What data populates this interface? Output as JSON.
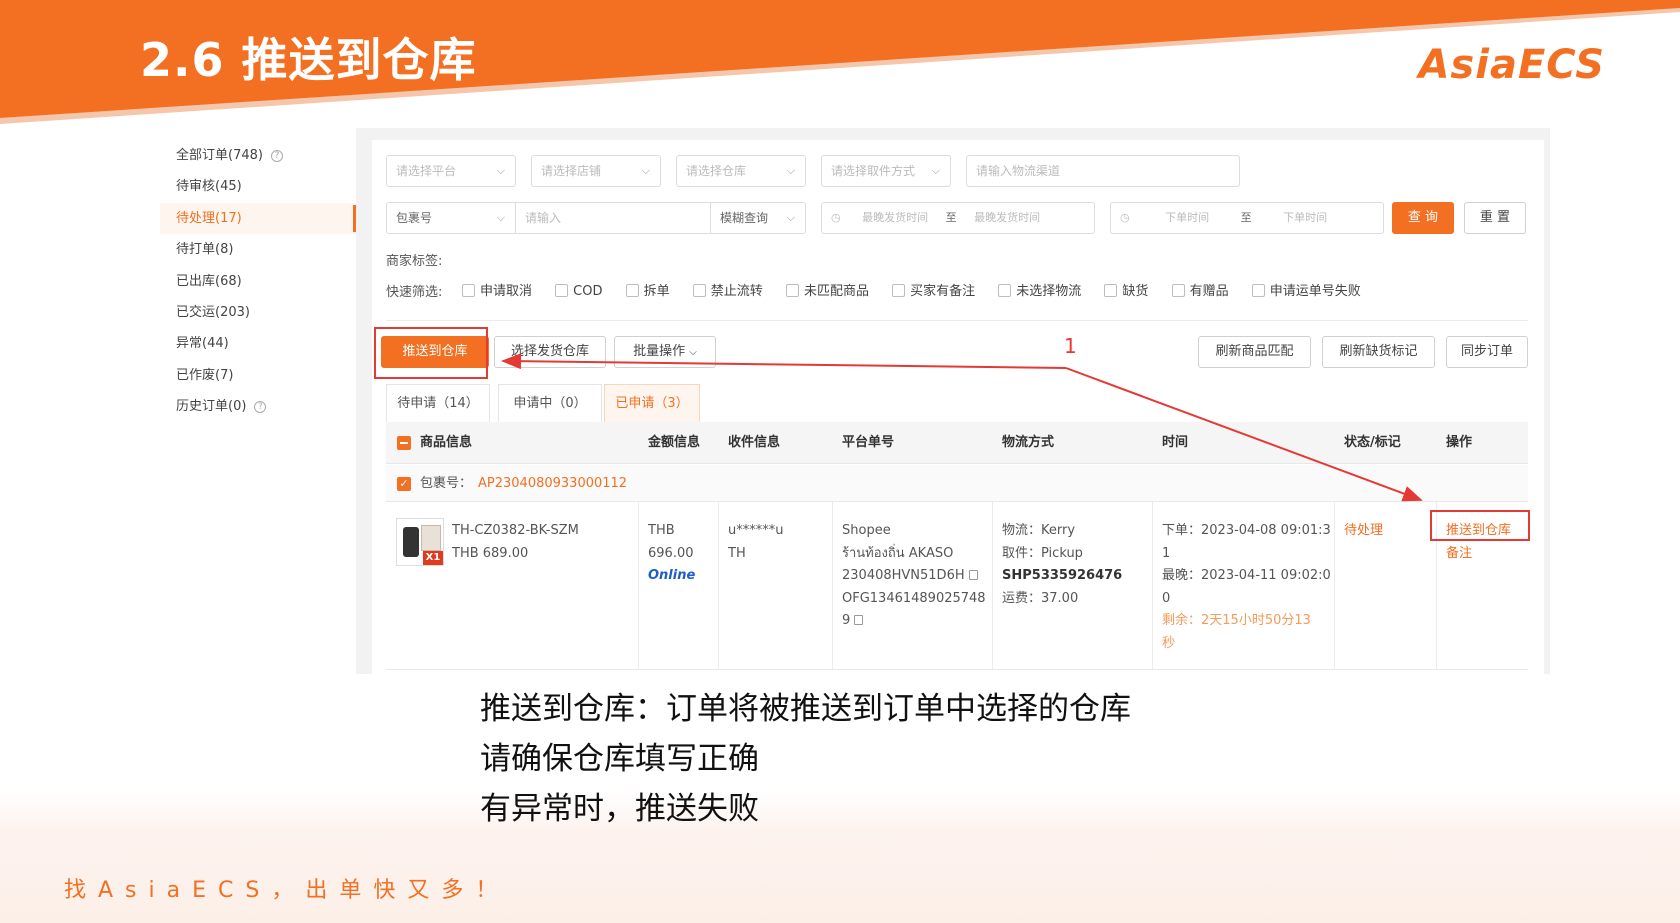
{
  "slide": {
    "title": "2.6 推送到仓库",
    "brand": "AsiaECS",
    "slogan": "找AsiaECS，出单快又多！",
    "colors": {
      "accent": "#f36f21",
      "annotation": "#e53935"
    }
  },
  "sidebar": {
    "items": [
      {
        "label": "全部订单(748)",
        "help": "?"
      },
      {
        "label": "待审核(45)"
      },
      {
        "label": "待处理(17)",
        "active": true
      },
      {
        "label": "待打单(8)"
      },
      {
        "label": "已出库(68)"
      },
      {
        "label": "已交运(203)"
      },
      {
        "label": "异常(44)"
      },
      {
        "label": "已作废(7)"
      },
      {
        "label": "历史订单(0)",
        "help": "?"
      }
    ]
  },
  "search": {
    "platform_placeholder": "请选择平台",
    "shop_placeholder": "请选择店铺",
    "warehouse_placeholder": "请选择仓库",
    "pickup_placeholder": "请选择取件方式",
    "channel_placeholder": "请输入物流渠道",
    "field_type": "包裹号",
    "input_placeholder": "请输入",
    "match_mode": "模糊查询",
    "ship_start": "最晚发货时间",
    "ship_to": "至",
    "ship_end": "最晚发货时间",
    "order_start": "下单时间",
    "order_to": "至",
    "order_end": "下单时间",
    "query_button": "查 询",
    "reset_button": "重 置",
    "merchant_tags_label": "商家标签:",
    "quick_filter_label": "快速筛选:",
    "quick_filters": [
      "申请取消",
      "COD",
      "拆单",
      "禁止流转",
      "未匹配商品",
      "买家有备注",
      "未选择物流",
      "缺货",
      "有赠品",
      "申请运单号失败"
    ]
  },
  "actions": {
    "push_warehouse": "推送到仓库",
    "select_warehouse": "选择发货仓库",
    "batch": "批量操作",
    "refresh_match": "刷新商品匹配",
    "refresh_stock": "刷新缺货标记",
    "sync_orders": "同步订单"
  },
  "tabs": [
    {
      "label": "待申请（14）"
    },
    {
      "label": "申请中（0）"
    },
    {
      "label": "已申请（3）",
      "active": true
    }
  ],
  "table": {
    "headers": [
      "商品信息",
      "金额信息",
      "收件信息",
      "平台单号",
      "物流方式",
      "时间",
      "状态/标记",
      "操作"
    ],
    "package_label": "包裹号：",
    "package_no": "AP2304080933000112",
    "row": {
      "thumb_badge": "X1",
      "sku": "TH-CZ0382-BK-SZM",
      "sku_price": "THB 689.00",
      "currency": "THB",
      "amount": "696.00",
      "pay_type": "Online",
      "recipient": "u******u",
      "country": "TH",
      "platform": "Shopee",
      "shop": "ร้านท้องถิ่น AKASO",
      "platform_order": "230408HVN51D6H",
      "tracking_1": "OFG13461489025748",
      "tracking_2": "9",
      "logistics": "物流：Kerry",
      "pickup": "取件：Pickup",
      "waybill": "SHP5335926476",
      "freight": "运费：37.00",
      "order_time_1": "下单：2023-04-08 09:01:3",
      "order_time_2": "1",
      "latest_1": "最晚：2023-04-11 09:02:0",
      "latest_2": "0",
      "remain_1": "剩余：2天15小时50分13",
      "remain_2": "秒",
      "status": "待处理",
      "op_push": "推送到仓库",
      "op_note": "备注"
    }
  },
  "annotation": {
    "number": "1"
  },
  "caption": {
    "line1": "推送到仓库：订单将被推送到订单中选择的仓库",
    "line2": "请确保仓库填写正确",
    "line3": "有异常时，推送失败"
  }
}
